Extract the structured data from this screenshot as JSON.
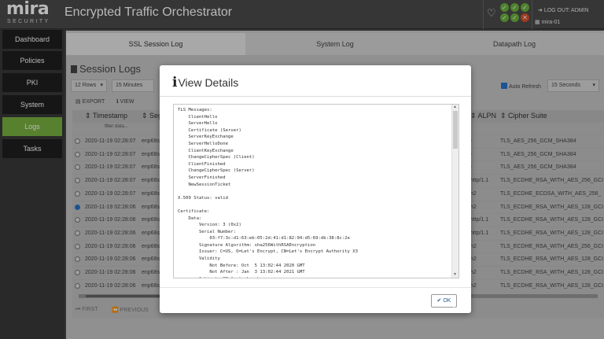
{
  "app": {
    "logo": "mira",
    "logo_sub": "SECURITY",
    "title": "Encrypted Traffic Orchestrator",
    "logout": "LOG OUT: ADMIN",
    "host": "mira-01",
    "status_colors": {
      "ok": "#6cb33f",
      "error": "#d9532c"
    }
  },
  "sidebar": {
    "items": [
      {
        "label": "Dashboard"
      },
      {
        "label": "Policies"
      },
      {
        "label": "PKI"
      },
      {
        "label": "System"
      },
      {
        "label": "Logs"
      },
      {
        "label": "Tasks"
      }
    ],
    "active": "Logs",
    "accent": "#7ab342"
  },
  "tabs": [
    {
      "label": "SSL Session Log"
    },
    {
      "label": "System Log"
    },
    {
      "label": "Datapath Log"
    }
  ],
  "section_title": "Session Logs",
  "controls": {
    "rows": "12 Rows",
    "interval": "15 Minutes",
    "auto_refresh": "Auto Refresh",
    "refresh_rate": "15 Seconds"
  },
  "toolbar": {
    "export": "EXPORT",
    "view": "VIEW"
  },
  "grid": {
    "columns": {
      "timestamp": "Timestamp",
      "segment": "Segm",
      "alpn": "ALPN",
      "cipher": "Cipher Suite"
    },
    "filter_placeholder": "filter data...",
    "rows": [
      {
        "ts": "2020-11-19 02:28:07",
        "seg": "enp68s",
        "alpn": "-",
        "cipher": "TLS_AES_256_GCM_SHA384"
      },
      {
        "ts": "2020-11-19 02:28:07",
        "seg": "enp68s",
        "alpn": "-",
        "cipher": "TLS_AES_256_GCM_SHA384"
      },
      {
        "ts": "2020-11-19 02:28:07",
        "seg": "enp68s",
        "alpn": "-",
        "cipher": "TLS_AES_256_GCM_SHA384"
      },
      {
        "ts": "2020-11-19 02:28:07",
        "seg": "enp68s",
        "alpn": "http/1.1",
        "cipher": "TLS_ECDHE_RSA_WITH_AES_256_GCI"
      },
      {
        "ts": "2020-11-19 02:28:07",
        "seg": "enp68s",
        "alpn": "h2",
        "cipher": "TLS_ECDHE_ECDSA_WITH_AES_256_"
      },
      {
        "ts": "2020-11-19 02:28:06",
        "seg": "enp68s",
        "alpn": "h2",
        "cipher": "TLS_ECDHE_RSA_WITH_AES_128_GCI"
      },
      {
        "ts": "2020-11-19 02:28:06",
        "seg": "enp68s",
        "alpn": "http/1.1",
        "cipher": "TLS_ECDHE_RSA_WITH_AES_128_GCI"
      },
      {
        "ts": "2020-11-19 02:28:06",
        "seg": "enp68s",
        "alpn": "http/1.1",
        "cipher": "TLS_ECDHE_RSA_WITH_AES_128_GCI"
      },
      {
        "ts": "2020-11-19 02:28:06",
        "seg": "enp68s",
        "alpn": "h2",
        "cipher": "TLS_ECDHE_RSA_WITH_AES_256_GCI"
      },
      {
        "ts": "2020-11-19 02:28:06",
        "seg": "enp68s",
        "alpn": "h2",
        "cipher": "TLS_ECDHE_RSA_WITH_AES_128_GCI"
      },
      {
        "ts": "2020-11-19 02:28:06",
        "seg": "enp68s",
        "alpn": "h2",
        "cipher": "TLS_ECDHE_RSA_WITH_AES_128_GCI"
      },
      {
        "ts": "2020-11-19 02:28:06",
        "seg": "enp68s",
        "alpn": "h2",
        "cipher": "TLS_ECDHE_RSA_WITH_AES_128_GCI"
      }
    ],
    "selected_row": 5
  },
  "pager": {
    "first": "FIRST",
    "previous": "PREVIOUS"
  },
  "modal": {
    "title": "View Details",
    "ok": "OK",
    "details": "TLS Messages:\n    ClientHello\n    ServerHello\n    Certificate (Server)\n    ServerKeyExchange\n    ServerHelloDone\n    ClientKeyExchange\n    ChangeCipherSpec (Client)\n    ClientFinished\n    ChangeCipherSpec (Server)\n    ServerFinished\n    NewSessionTicket\n\nX.509 Status: valid\n\nCertificate:\n    Data:\n        Version: 3 (0x2)\n        Serial Number:\n            03:f7:3c:d1:63:eb:05:2d:41:d1:82:94:d5:69:db:38:8c:2e\n        Signature Algorithm: sha256WithRSAEncryption\n        Issuer: C=US, O=Let's Encrypt, CN=Let's Encrypt Authority X3\n        Validity\n            Not Before: Oct  5 13:02:44 2020 GMT\n            Not After : Jan  3 13:02:44 2021 GMT\n        Subject: CN=*.stackexchange.com\n        Subject Public Key Info:"
  }
}
